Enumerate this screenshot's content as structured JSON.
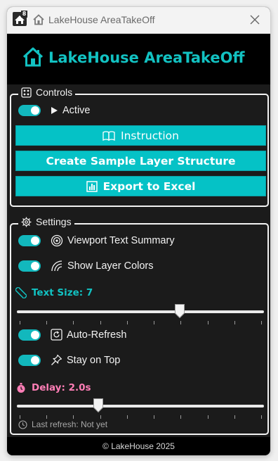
{
  "window": {
    "title": "LakeHouse AreaTakeOff",
    "app_icon_badge": "8"
  },
  "header": {
    "title": "LakeHouse AreaTakeOff",
    "icon": "house-icon",
    "accent_color": "#12c2c2"
  },
  "controls": {
    "legend": "Controls",
    "active_label": "Active",
    "active_on": true,
    "buttons": {
      "instruction": "Instruction",
      "create_sample": "Create Sample Layer Structure",
      "export_excel": "Export to Excel"
    },
    "button_color": "#05c2c6"
  },
  "settings": {
    "legend": "Settings",
    "viewport_text_summary": "Viewport Text Summary",
    "viewport_text_summary_on": true,
    "show_layer_colors": "Show Layer Colors",
    "show_layer_colors_on": true,
    "text_size_label": "Text Size: 7",
    "text_size_value": 7,
    "text_size_fraction": 0.66,
    "auto_refresh": "Auto-Refresh",
    "auto_refresh_on": true,
    "stay_on_top": "Stay on Top",
    "stay_on_top_on": true,
    "delay_label": "Delay: 2.0s",
    "delay_value": 2.0,
    "delay_fraction": 0.33,
    "last_refresh": "Last refresh: Not yet",
    "text_size_color": "#12c2c2",
    "delay_color": "#ff7eb6"
  },
  "footer": {
    "text": "© LakeHouse 2025"
  }
}
